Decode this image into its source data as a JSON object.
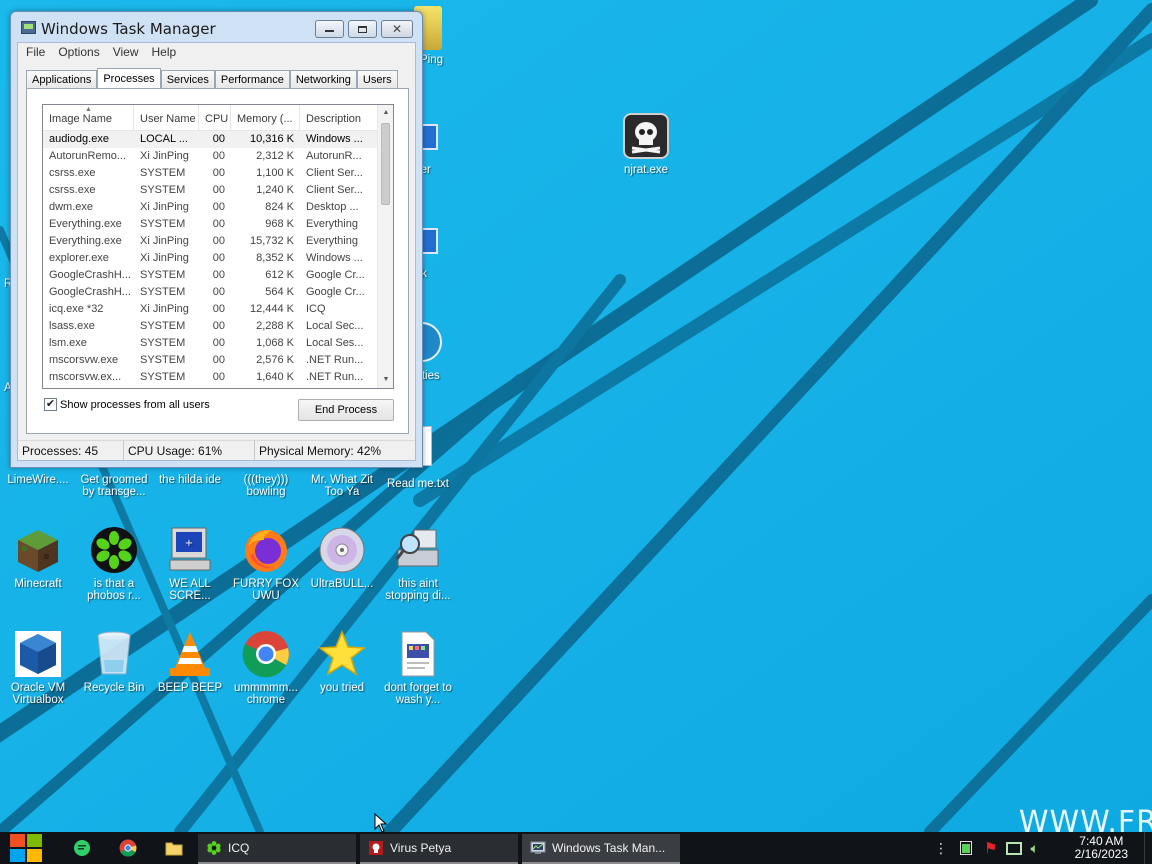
{
  "window": {
    "title": "Windows Task Manager",
    "menu": [
      "File",
      "Options",
      "View",
      "Help"
    ],
    "tabs": [
      "Applications",
      "Processes",
      "Services",
      "Performance",
      "Networking",
      "Users"
    ],
    "active_tab": "Processes",
    "columns": [
      "Image Name",
      "User Name",
      "CPU",
      "Memory (...",
      "Description"
    ],
    "processes": [
      {
        "image": "audiodg.exe",
        "user": "LOCAL ...",
        "cpu": "00",
        "mem": "10,316 K",
        "desc": "Windows ..."
      },
      {
        "image": "AutorunRemo...",
        "user": "Xi JinPing",
        "cpu": "00",
        "mem": "2,312 K",
        "desc": "AutorunR..."
      },
      {
        "image": "csrss.exe",
        "user": "SYSTEM",
        "cpu": "00",
        "mem": "1,100 K",
        "desc": "Client Ser..."
      },
      {
        "image": "csrss.exe",
        "user": "SYSTEM",
        "cpu": "00",
        "mem": "1,240 K",
        "desc": "Client Ser..."
      },
      {
        "image": "dwm.exe",
        "user": "Xi JinPing",
        "cpu": "00",
        "mem": "824 K",
        "desc": "Desktop ..."
      },
      {
        "image": "Everything.exe",
        "user": "SYSTEM",
        "cpu": "00",
        "mem": "968 K",
        "desc": "Everything"
      },
      {
        "image": "Everything.exe",
        "user": "Xi JinPing",
        "cpu": "00",
        "mem": "15,732 K",
        "desc": "Everything"
      },
      {
        "image": "explorer.exe",
        "user": "Xi JinPing",
        "cpu": "00",
        "mem": "8,352 K",
        "desc": "Windows ..."
      },
      {
        "image": "GoogleCrashH...",
        "user": "SYSTEM",
        "cpu": "00",
        "mem": "612 K",
        "desc": "Google Cr..."
      },
      {
        "image": "GoogleCrashH...",
        "user": "SYSTEM",
        "cpu": "00",
        "mem": "564 K",
        "desc": "Google Cr..."
      },
      {
        "image": "icq.exe *32",
        "user": "Xi JinPing",
        "cpu": "00",
        "mem": "12,444 K",
        "desc": "ICQ"
      },
      {
        "image": "lsass.exe",
        "user": "SYSTEM",
        "cpu": "00",
        "mem": "2,288 K",
        "desc": "Local Sec..."
      },
      {
        "image": "lsm.exe",
        "user": "SYSTEM",
        "cpu": "00",
        "mem": "1,068 K",
        "desc": "Local Ses..."
      },
      {
        "image": "mscorsvw.exe",
        "user": "SYSTEM",
        "cpu": "00",
        "mem": "2,576 K",
        "desc": ".NET Run..."
      },
      {
        "image": "mscorsvw.ex...",
        "user": "SYSTEM",
        "cpu": "00",
        "mem": "1,640 K",
        "desc": ".NET Run..."
      }
    ],
    "show_all_label": "Show processes from all users",
    "show_all_checked": true,
    "end_process_label": "End Process",
    "status": {
      "processes": "Processes: 45",
      "cpu": "CPU Usage: 61%",
      "memory": "Physical Memory: 42%"
    }
  },
  "desktop": {
    "partial_labels": {
      "ping": "Ping",
      "computer": "uter",
      "network": "ork",
      "utilities": "tilities",
      "left_r": "R",
      "left_a": "A"
    },
    "icons": [
      {
        "label": "njrat.exe",
        "icon": "skull-icon"
      },
      {
        "label": "LimeWire....",
        "icon": "limewire-icon"
      },
      {
        "label": "Get groomed by transge...",
        "icon": "file-icon"
      },
      {
        "label": "the hilda ide",
        "icon": "file-icon"
      },
      {
        "label": "(((they))) bowling",
        "icon": "file-icon"
      },
      {
        "label": "Mr. What Zit Too Ya",
        "icon": "file-icon"
      },
      {
        "label": "Read me.txt",
        "icon": "text-file-icon"
      },
      {
        "label": "Minecraft",
        "icon": "minecraft-icon"
      },
      {
        "label": "is that a phobos r...",
        "icon": "icq-icon"
      },
      {
        "label": "WE ALL SCRE...",
        "icon": "computer-icon"
      },
      {
        "label": "FURRY FOX UWU",
        "icon": "firefox-icon"
      },
      {
        "label": "UltraBULL...",
        "icon": "disc-icon"
      },
      {
        "label": "this aint stopping di...",
        "icon": "scanner-icon"
      },
      {
        "label": "Oracle VM Virtualbox",
        "icon": "virtualbox-icon"
      },
      {
        "label": "Recycle Bin",
        "icon": "recycle-bin-icon"
      },
      {
        "label": "BEEP BEEP",
        "icon": "vlc-icon"
      },
      {
        "label": "ummmmm... chrome",
        "icon": "chrome-icon"
      },
      {
        "label": "you tried",
        "icon": "star-icon"
      },
      {
        "label": "dont forget to wash y...",
        "icon": "document-icon"
      }
    ],
    "watermark": "WWW.FR"
  },
  "taskbar": {
    "buttons": [
      {
        "label": "ICQ",
        "icon": "icq-icon"
      },
      {
        "label": "Virus Petya",
        "icon": "petya-icon"
      },
      {
        "label": "Windows Task Man...",
        "icon": "task-manager-icon"
      }
    ],
    "clock_time": "7:40 AM",
    "clock_date": "2/16/2023"
  },
  "colors": {
    "desktop": "#12b3e8",
    "taskbar": "#101418",
    "window_frame": "#cfe1f4"
  }
}
